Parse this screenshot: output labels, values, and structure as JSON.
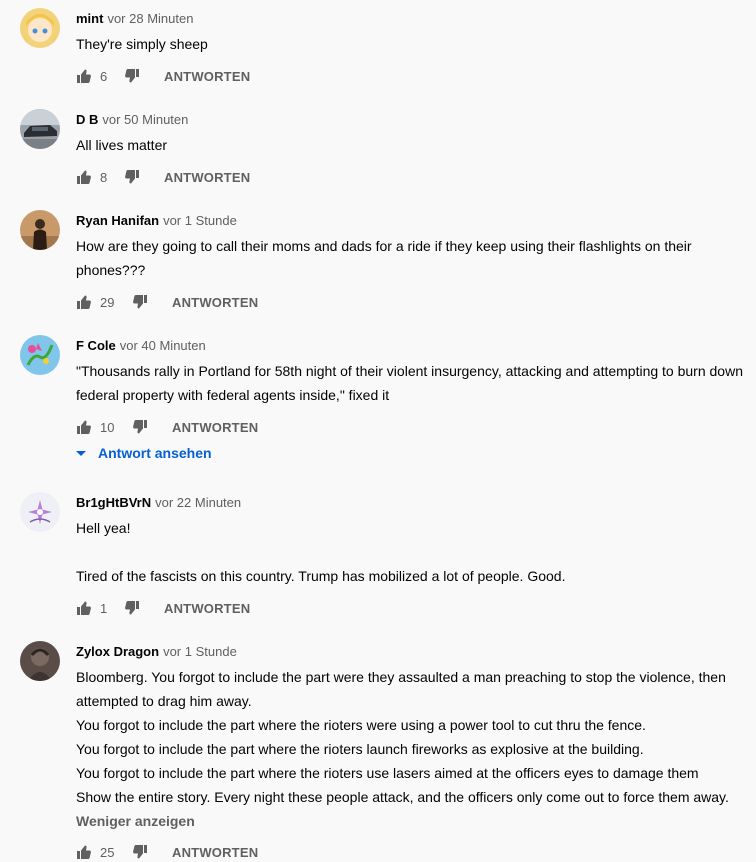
{
  "comments": [
    {
      "author": "mint",
      "time": "vor 28 Minuten",
      "lines": [
        "They're simply sheep"
      ],
      "likes": "6",
      "reply_label": "ANTWORTEN"
    },
    {
      "author": "D B",
      "time": "vor 50 Minuten",
      "lines": [
        "All lives matter"
      ],
      "likes": "8",
      "reply_label": "ANTWORTEN"
    },
    {
      "author": "Ryan Hanifan",
      "time": "vor 1 Stunde",
      "lines": [
        "How are they going to call their moms and dads for a ride if they keep using their flashlights on their phones???"
      ],
      "likes": "29",
      "reply_label": "ANTWORTEN"
    },
    {
      "author": "F Cole",
      "time": "vor 40 Minuten",
      "lines": [
        "\"Thousands rally in Portland for 58th night of their violent insurgency, attacking and attempting to burn down federal property with federal agents inside,\" fixed it"
      ],
      "likes": "10",
      "reply_label": "ANTWORTEN",
      "view_replies": "Antwort ansehen"
    },
    {
      "author": "Br1gHtBVrN",
      "time": "vor 22 Minuten",
      "lines": [
        "Hell yea!",
        "Tired of the fascists on this country. Trump has mobilized a lot of people. Good."
      ],
      "likes": "1",
      "reply_label": "ANTWORTEN"
    },
    {
      "author": "Zylox Dragon",
      "time": "vor 1 Stunde",
      "lines": [
        "Bloomberg. You forgot to include the part were they assaulted a man preaching to stop the violence, then attempted to drag him away.",
        "You forgot to include the part where the rioters were using a power tool to cut thru the fence.",
        "You forgot to include the part where the rioters launch fireworks as explosive at the building.",
        "You forgot to include the part where the rioters use lasers aimed at the officers eyes to damage them",
        "Show the entire story. Every night these people attack, and the officers only come out to force them away."
      ],
      "show_less": "Weniger anzeigen",
      "likes": "25",
      "reply_label": "ANTWORTEN"
    }
  ],
  "icons": {
    "like": "thumbs-up-icon",
    "dislike": "thumbs-down-icon",
    "expand": "caret-down-icon"
  },
  "colors": {
    "background": "#f9f9f9",
    "link": "#065fd4",
    "secondary_text": "#606060"
  }
}
